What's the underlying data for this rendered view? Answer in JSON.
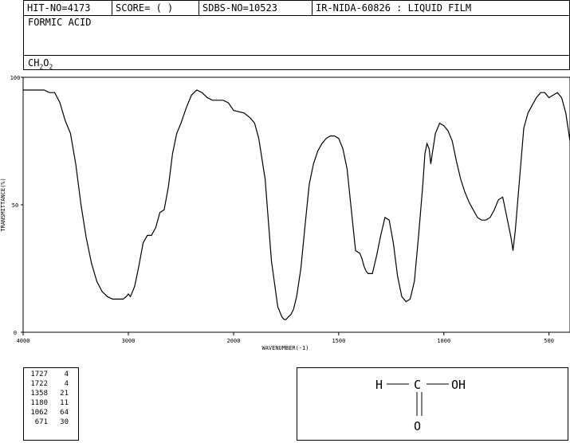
{
  "header": {
    "hit_no": "HIT-NO=4173",
    "score": "SCORE=  (   )",
    "sdbs_no": "SDBS-NO=10523",
    "ir_info": "IR-NIDA-60826 : LIQUID FILM"
  },
  "compound": {
    "name": "FORMIC ACID",
    "formula_parts": [
      "CH",
      "2",
      "O",
      "2"
    ]
  },
  "peaks": [
    {
      "wavenumber": "1727",
      "transmittance": "4"
    },
    {
      "wavenumber": "1722",
      "transmittance": "4"
    },
    {
      "wavenumber": "1358",
      "transmittance": "21"
    },
    {
      "wavenumber": "1180",
      "transmittance": "11"
    },
    {
      "wavenumber": "1062",
      "transmittance": "64"
    },
    {
      "wavenumber": "671",
      "transmittance": "30"
    }
  ],
  "structure": {
    "left_atom": "H",
    "center_atom": "C",
    "right_group": "OH",
    "bottom_atom": "O"
  },
  "chart_data": {
    "type": "line",
    "title": "",
    "xlabel": "WAVENUMBER(-1)",
    "ylabel": "TRANSMITTANCE(%)",
    "xlim": [
      4000,
      400
    ],
    "ylim": [
      0,
      100
    ],
    "x_ticks": [
      4000,
      3000,
      2000,
      1500,
      1000,
      500
    ],
    "x_tick_labels": [
      "4000",
      "3000",
      "2000",
      "1500",
      "1000",
      "500"
    ],
    "y_ticks": [
      0,
      50,
      100
    ],
    "y_tick_labels": [
      "0",
      "50",
      "100"
    ],
    "grid": false,
    "series": [
      {
        "x": [
          4000,
          3900,
          3800,
          3750,
          3700,
          3650,
          3600,
          3550,
          3500,
          3450,
          3400,
          3350,
          3300,
          3250,
          3200,
          3150,
          3100,
          3050,
          3020,
          3000,
          2980,
          2960,
          2940,
          2900,
          2860,
          2820,
          2780,
          2740,
          2700,
          2660,
          2620,
          2580,
          2540,
          2500,
          2450,
          2400,
          2350,
          2300,
          2250,
          2200,
          2150,
          2100,
          2050,
          2000,
          1950,
          1920,
          1900,
          1880,
          1850,
          1820,
          1790,
          1770,
          1760,
          1750,
          1740,
          1727,
          1715,
          1700,
          1680,
          1660,
          1640,
          1620,
          1600,
          1580,
          1560,
          1540,
          1520,
          1500,
          1480,
          1460,
          1440,
          1420,
          1400,
          1390,
          1380,
          1370,
          1360,
          1340,
          1320,
          1300,
          1280,
          1260,
          1240,
          1220,
          1200,
          1180,
          1160,
          1140,
          1120,
          1100,
          1090,
          1080,
          1070,
          1062,
          1055,
          1040,
          1020,
          1000,
          980,
          960,
          940,
          920,
          900,
          880,
          860,
          840,
          820,
          800,
          780,
          760,
          740,
          720,
          705,
          690,
          680,
          671,
          660,
          640,
          620,
          600,
          580,
          560,
          540,
          520,
          500,
          480,
          460,
          440,
          420,
          400
        ],
        "y": [
          95,
          95,
          95,
          94,
          94,
          90,
          83,
          78,
          66,
          50,
          37,
          27,
          20,
          16,
          14,
          13,
          13,
          13,
          14,
          15,
          14,
          16,
          18,
          26,
          35,
          38,
          38,
          41,
          47,
          48,
          57,
          70,
          78,
          82,
          88,
          93,
          95,
          94,
          92,
          91,
          91,
          91,
          90,
          87,
          86,
          84,
          82,
          76,
          60,
          28,
          10,
          6,
          5,
          5,
          6,
          7,
          9,
          14,
          25,
          42,
          58,
          66,
          71,
          74,
          76,
          77,
          77,
          76,
          72,
          64,
          48,
          32,
          31,
          29,
          26,
          24,
          23,
          23,
          30,
          38,
          45,
          44,
          35,
          22,
          14,
          12,
          13,
          20,
          38,
          58,
          70,
          74,
          72,
          66,
          70,
          78,
          82,
          81,
          79,
          75,
          67,
          60,
          55,
          51,
          48,
          45,
          44,
          44,
          45,
          48,
          52,
          53,
          47,
          41,
          37,
          32,
          40,
          60,
          80,
          86,
          89,
          92,
          94,
          94,
          92,
          93,
          94,
          92,
          86,
          75
        ]
      }
    ]
  }
}
